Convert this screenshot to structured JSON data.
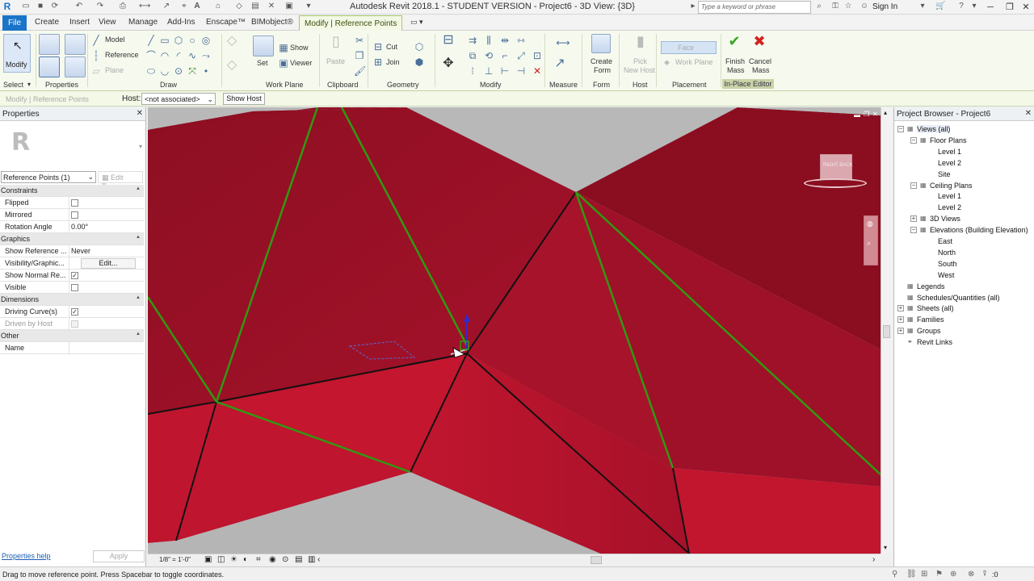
{
  "window": {
    "title": "Autodesk Revit 2018.1 - STUDENT VERSION -    Project6 - 3D View: {3D}",
    "search_placeholder": "Type a keyword or phrase",
    "sign_in": "Sign In"
  },
  "tabs": [
    "File",
    "Create",
    "Insert",
    "View",
    "Manage",
    "Add-Ins",
    "Enscape™",
    "BIMobject®",
    "Modify | Reference Points"
  ],
  "ribbon": {
    "select": {
      "modify": "Modify",
      "select": "Select"
    },
    "properties": "Properties",
    "draw": {
      "model": "Model",
      "reference": "Reference",
      "plane": "Plane",
      "label": "Draw"
    },
    "workplane": {
      "set": "Set",
      "show": "Show",
      "viewer": "Viewer",
      "label": "Work Plane"
    },
    "clipboard": {
      "paste": "Paste",
      "label": "Clipboard"
    },
    "geometry": {
      "cut": "Cut",
      "join": "Join",
      "label": "Geometry"
    },
    "modify": "Modify",
    "measure": "Measure",
    "form": {
      "create_line1": "Create",
      "create_line2": "Form",
      "label": "Form"
    },
    "host": {
      "pick_line1": "Pick",
      "pick_line2": "New Host",
      "label": "Host"
    },
    "placement": {
      "face": "Face",
      "work_plane": "Work Plane",
      "label": "Placement"
    },
    "inplace": {
      "finish_line1": "Finish",
      "finish_line2": "Mass",
      "cancel_line1": "Cancel",
      "cancel_line2": "Mass",
      "label": "In-Place Editor"
    }
  },
  "options_bar": {
    "context": "Modify | Reference Points",
    "host_label": "Host:",
    "host_value": "<not associated>",
    "show_host": "Show Host"
  },
  "properties": {
    "title": "Properties",
    "type_selector": "Reference Points (1)",
    "edit_type": "Edit Type",
    "rows": [
      {
        "group": true,
        "label": "Constraints"
      },
      {
        "label": "Flipped",
        "check": false
      },
      {
        "label": "Mirrored",
        "check": false
      },
      {
        "label": "Rotation Angle",
        "value": "0.00°"
      },
      {
        "group": true,
        "label": "Graphics"
      },
      {
        "label": "Show Reference ...",
        "value": "Never"
      },
      {
        "label": "Visibility/Graphic...",
        "button": "Edit..."
      },
      {
        "label": "Show Normal Re...",
        "check": true
      },
      {
        "label": "Visible",
        "check": false
      },
      {
        "group": true,
        "label": "Dimensions"
      },
      {
        "label": "Driving Curve(s)",
        "check": true
      },
      {
        "label": "Driven by Host",
        "check": false,
        "disabled": true
      },
      {
        "group": true,
        "label": "Other"
      },
      {
        "label": "Name",
        "value": ""
      }
    ],
    "help": "Properties help",
    "apply": "Apply"
  },
  "viewport": {
    "scale": "1/8\" = 1'-0\"",
    "viewcube_label": "RIGHT  BACK"
  },
  "browser": {
    "title": "Project Browser - Project6",
    "nodes": [
      {
        "label": "Views (all)",
        "level": 0,
        "expander": "−",
        "selected": true
      },
      {
        "label": "Floor Plans",
        "level": 1,
        "expander": "−"
      },
      {
        "label": "Level 1",
        "level": 2
      },
      {
        "label": "Level 2",
        "level": 2
      },
      {
        "label": "Site",
        "level": 2
      },
      {
        "label": "Ceiling Plans",
        "level": 1,
        "expander": "−"
      },
      {
        "label": "Level 1",
        "level": 2
      },
      {
        "label": "Level 2",
        "level": 2
      },
      {
        "label": "3D Views",
        "level": 1,
        "expander": "+"
      },
      {
        "label": "Elevations (Building Elevation)",
        "level": 1,
        "expander": "−"
      },
      {
        "label": "East",
        "level": 2
      },
      {
        "label": "North",
        "level": 2
      },
      {
        "label": "South",
        "level": 2
      },
      {
        "label": "West",
        "level": 2
      },
      {
        "label": "Legends",
        "level": 0
      },
      {
        "label": "Schedules/Quantities (all)",
        "level": 0
      },
      {
        "label": "Sheets (all)",
        "level": 0,
        "expander": "+"
      },
      {
        "label": "Families",
        "level": 0,
        "expander": "+"
      },
      {
        "label": "Groups",
        "level": 0,
        "expander": "+"
      },
      {
        "label": "Revit Links",
        "level": 0
      }
    ]
  },
  "status": {
    "message": "Drag to move reference point. Press Spacebar to toggle coordinates.",
    "count": ":0"
  },
  "colors": {
    "surface_dark": "#8c0f22",
    "surface_mid": "#b3132e",
    "surface_light": "#c8172f",
    "edge_green": "#2f9a12",
    "accent_blue": "#1a74c9"
  }
}
